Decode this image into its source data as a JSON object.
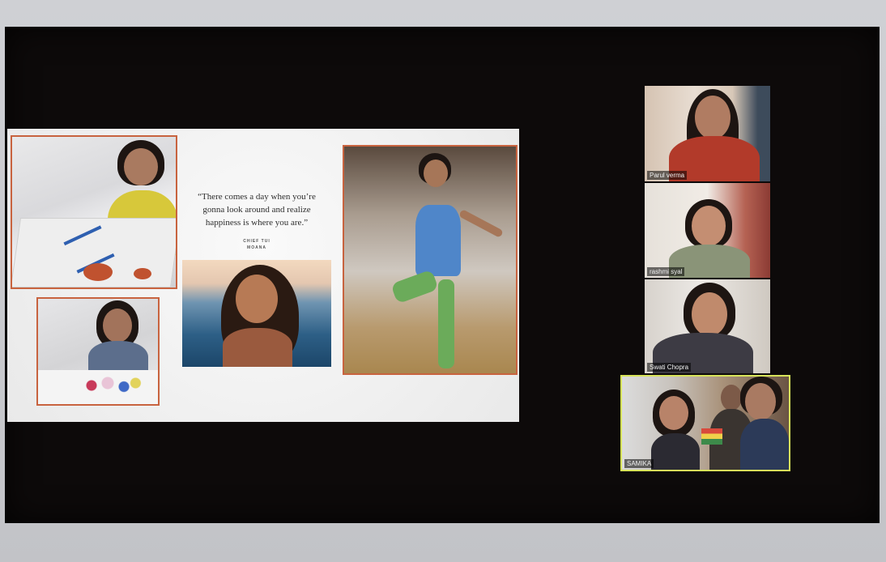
{
  "shared_slide": {
    "quote": "“There comes a day when you’re gonna look around and realize happiness is where you are.”",
    "attribution_name": "CHIEF TUI",
    "attribution_source": "MOANA"
  },
  "participants": [
    {
      "name": "Parul verma"
    },
    {
      "name": "rashmi syal"
    },
    {
      "name": "Swati Chopra"
    },
    {
      "name": "SAMIKA",
      "active_speaker": true
    }
  ],
  "colors": {
    "photo_frame": "#c8633f",
    "active_speaker_border": "#d7e35a",
    "screen_background": "#0d0a0a"
  }
}
